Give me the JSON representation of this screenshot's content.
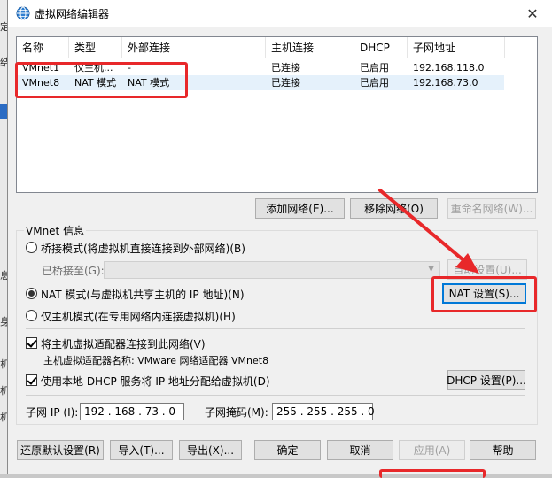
{
  "background": {
    "side_chars": [
      "定",
      "结",
      "息",
      "身",
      "机",
      "机",
      "机"
    ]
  },
  "window": {
    "title": "虚拟网络编辑器",
    "close_glyph": "✕"
  },
  "network_table": {
    "columns": [
      "名称",
      "类型",
      "外部连接",
      "主机连接",
      "DHCP",
      "子网地址"
    ],
    "rows": [
      {
        "name": "VMnet1",
        "type": "仅主机...",
        "external": "-",
        "host": "已连接",
        "dhcp": "已启用",
        "subnet": "192.168.118.0",
        "selected": false
      },
      {
        "name": "VMnet8",
        "type": "NAT 模式",
        "external": "NAT 模式",
        "host": "已连接",
        "dhcp": "已启用",
        "subnet": "192.168.73.0",
        "selected": true
      }
    ]
  },
  "list_buttons": {
    "add": "添加网络(E)...",
    "remove": "移除网络(O)",
    "rename": "重命名网络(W)..."
  },
  "vmnet_info": {
    "group_label": "VMnet 信息",
    "bridged_label": "桥接模式(将虚拟机直接连接到外部网络)(B)",
    "bridged_to_label": "已桥接至(G):",
    "bridged_to_value": "",
    "auto_settings_button": "自动设置(U)...",
    "nat_label": "NAT 模式(与虚拟机共享主机的 IP 地址)(N)",
    "nat_settings_button": "NAT 设置(S)...",
    "host_only_label": "仅主机模式(在专用网络内连接虚拟机)(H)",
    "selected_mode": "nat",
    "connect_adapter_label": "将主机虚拟适配器连接到此网络(V)",
    "connect_adapter_checked": true,
    "adapter_name_text": "主机虚拟适配器名称: VMware 网络适配器 VMnet8",
    "dhcp_label": "使用本地 DHCP 服务将 IP 地址分配给虚拟机(D)",
    "dhcp_checked": true,
    "dhcp_settings_button": "DHCP 设置(P)...",
    "subnet_ip_label": "子网 IP (I):",
    "subnet_ip_value": "192 . 168 . 73 . 0",
    "subnet_mask_label": "子网掩码(M):",
    "subnet_mask_value": "255 . 255 . 255 . 0"
  },
  "footer_buttons": {
    "restore_defaults": "还原默认设置(R)",
    "import": "导入(T)...",
    "export": "导出(X)...",
    "ok": "确定",
    "cancel": "取消",
    "apply": "应用(A)",
    "help": "帮助"
  },
  "colors": {
    "annotation_red": "#e8282a",
    "selection": "#e5f1fb",
    "default_button_border": "#0078d7"
  }
}
